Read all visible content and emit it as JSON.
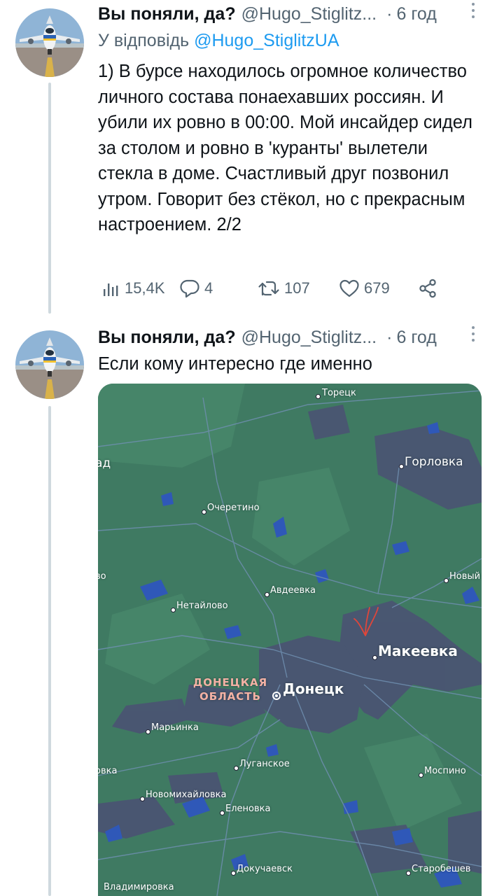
{
  "tweets": [
    {
      "author_name": "Вы поняли, да?",
      "handle": "@Hugo_Stiglitz...",
      "separator": "·",
      "time": "6 год",
      "reply_prefix": "У відповідь",
      "reply_mention": "@Hugo_StiglitzUA",
      "text": "1) В бурсе находилось огромное количество личного состава понаехавших россиян. И убили их ровно в 00:00. Мой инсайдер сидел за столом и ровно в 'куранты' вылетели стекла в доме. Счастливый друг позвонил утром. Говорит без стёкол, но с прекрасным настроением. 2/2",
      "views": "15,4K",
      "replies": "4",
      "retweets": "107",
      "likes": "679"
    },
    {
      "author_name": "Вы поняли, да?",
      "handle": "@Hugo_Stiglitz...",
      "separator": "·",
      "time": "6 год",
      "text": "Если кому интересно где именно"
    }
  ],
  "icons": {
    "views": "bar-chart-icon",
    "reply": "speech-bubble-icon",
    "retweet": "retweet-icon",
    "like": "heart-icon",
    "share": "share-icon",
    "more": "more-dots-icon"
  },
  "map": {
    "region_label": "ДОНЕЦКАЯ ОБЛАСТЬ",
    "places": {
      "toretsk": "Торецк",
      "gorlovka": "Горловка",
      "ad_edge": "ад",
      "ocheretino": "Очеретино",
      "vo_edge": "во",
      "noviy": "Новый",
      "avdeevka": "Авдеевка",
      "netaylovo": "Нетайлово",
      "makeevka": "Макеевка",
      "donetsk": "Донецк",
      "marinka": "Марьинка",
      "luganskoe": "Луганское",
      "ovka_edge": "овка",
      "mospino": "Моспино",
      "novomikhaylovka": "Новомихайловка",
      "elenovka": "Еленовка",
      "dokuchaevsk": "Докучаевск",
      "starobeshevo": "Старобешев",
      "vladimirovka": "Владимировка"
    }
  },
  "colors": {
    "map_base": "#3f7a62",
    "urban": "#4a5572",
    "water": "#2f58b8",
    "thread_line": "#cfd9de",
    "link": "#1d9bf0",
    "secondary_text": "#536471"
  }
}
